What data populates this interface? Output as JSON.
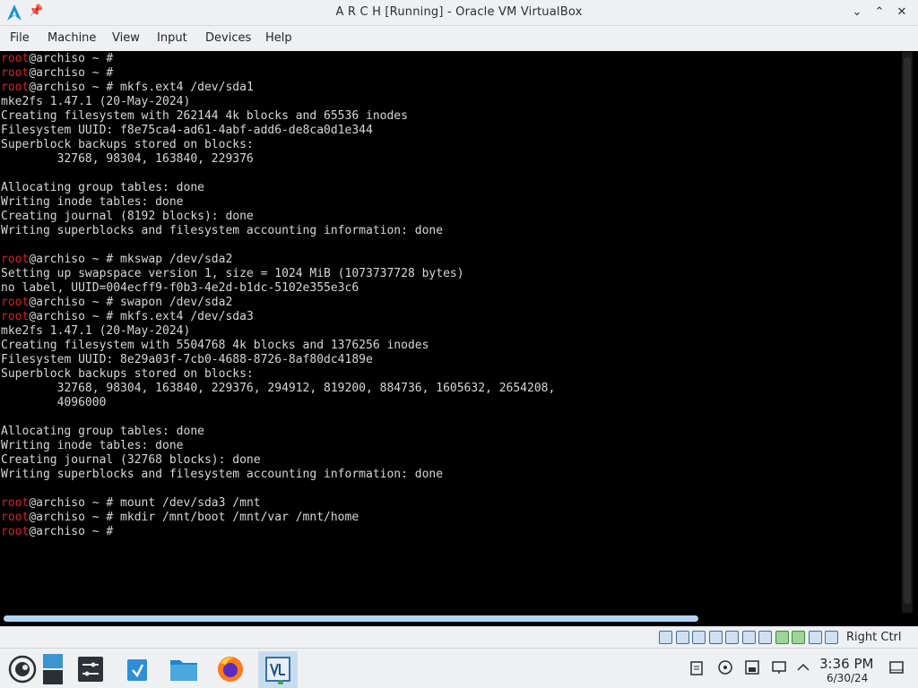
{
  "window": {
    "title": "A R C H [Running] - Oracle VM VirtualBox",
    "pin_glyph": "📌",
    "minimize_glyph": "⌄",
    "maximize_glyph": "⌃",
    "close_glyph": "✕"
  },
  "menu": {
    "items": [
      "File",
      "Machine",
      "View",
      "Input",
      "Devices",
      "Help"
    ]
  },
  "terminal": {
    "lines": [
      {
        "user": "root",
        "rest": "@archiso ~ #"
      },
      {
        "user": "root",
        "rest": "@archiso ~ #"
      },
      {
        "user": "root",
        "rest": "@archiso ~ # mkfs.ext4 /dev/sda1"
      },
      {
        "user": "",
        "rest": "mke2fs 1.47.1 (20-May-2024)"
      },
      {
        "user": "",
        "rest": "Creating filesystem with 262144 4k blocks and 65536 inodes"
      },
      {
        "user": "",
        "rest": "Filesystem UUID: f8e75ca4-ad61-4abf-add6-de8ca0d1e344"
      },
      {
        "user": "",
        "rest": "Superblock backups stored on blocks:"
      },
      {
        "user": "",
        "rest": "        32768, 98304, 163840, 229376"
      },
      {
        "user": "",
        "rest": ""
      },
      {
        "user": "",
        "rest": "Allocating group tables: done"
      },
      {
        "user": "",
        "rest": "Writing inode tables: done"
      },
      {
        "user": "",
        "rest": "Creating journal (8192 blocks): done"
      },
      {
        "user": "",
        "rest": "Writing superblocks and filesystem accounting information: done"
      },
      {
        "user": "",
        "rest": ""
      },
      {
        "user": "root",
        "rest": "@archiso ~ # mkswap /dev/sda2"
      },
      {
        "user": "",
        "rest": "Setting up swapspace version 1, size = 1024 MiB (1073737728 bytes)"
      },
      {
        "user": "",
        "rest": "no label, UUID=004ecff9-f0b3-4e2d-b1dc-5102e355e3c6"
      },
      {
        "user": "root",
        "rest": "@archiso ~ # swapon /dev/sda2"
      },
      {
        "user": "root",
        "rest": "@archiso ~ # mkfs.ext4 /dev/sda3"
      },
      {
        "user": "",
        "rest": "mke2fs 1.47.1 (20-May-2024)"
      },
      {
        "user": "",
        "rest": "Creating filesystem with 5504768 4k blocks and 1376256 inodes"
      },
      {
        "user": "",
        "rest": "Filesystem UUID: 8e29a03f-7cb0-4688-8726-8af80dc4189e"
      },
      {
        "user": "",
        "rest": "Superblock backups stored on blocks:"
      },
      {
        "user": "",
        "rest": "        32768, 98304, 163840, 229376, 294912, 819200, 884736, 1605632, 2654208,"
      },
      {
        "user": "",
        "rest": "        4096000"
      },
      {
        "user": "",
        "rest": ""
      },
      {
        "user": "",
        "rest": "Allocating group tables: done"
      },
      {
        "user": "",
        "rest": "Writing inode tables: done"
      },
      {
        "user": "",
        "rest": "Creating journal (32768 blocks): done"
      },
      {
        "user": "",
        "rest": "Writing superblocks and filesystem accounting information: done"
      },
      {
        "user": "",
        "rest": ""
      },
      {
        "user": "root",
        "rest": "@archiso ~ # mount /dev/sda3 /mnt"
      },
      {
        "user": "root",
        "rest": "@archiso ~ # mkdir /mnt/boot /mnt/var /mnt/home"
      },
      {
        "user": "root",
        "rest": "@archiso ~ #"
      }
    ]
  },
  "statusbar": {
    "host_key": "Right Ctrl",
    "indicator_icons": [
      "hard-disk-icon",
      "optical-drive-icon",
      "audio-icon",
      "network-icon",
      "usb-icon",
      "shared-folders-icon",
      "display-icon",
      "recording-icon",
      "mouse-integration-icon",
      "cpu-icon",
      "keyboard-capture-icon"
    ]
  },
  "taskbar": {
    "apps": [
      "opensuse-launcher-icon",
      "blue-app-icon",
      "system-settings-icon",
      "discover-icon",
      "file-manager-icon",
      "firefox-icon",
      "virtualbox-icon"
    ],
    "tray": [
      "clipboard-icon",
      "media-icon",
      "storage-icon",
      "network-icon",
      "show-hidden-icon"
    ],
    "time": "3:36 PM",
    "date": "6/30/24"
  },
  "colors": {
    "prompt_user": "#d2232a",
    "terminal_text": "#d7d7d7",
    "terminal_bg": "#000000",
    "chrome_bg": "#eef0f2",
    "accent": "#3daee9"
  }
}
